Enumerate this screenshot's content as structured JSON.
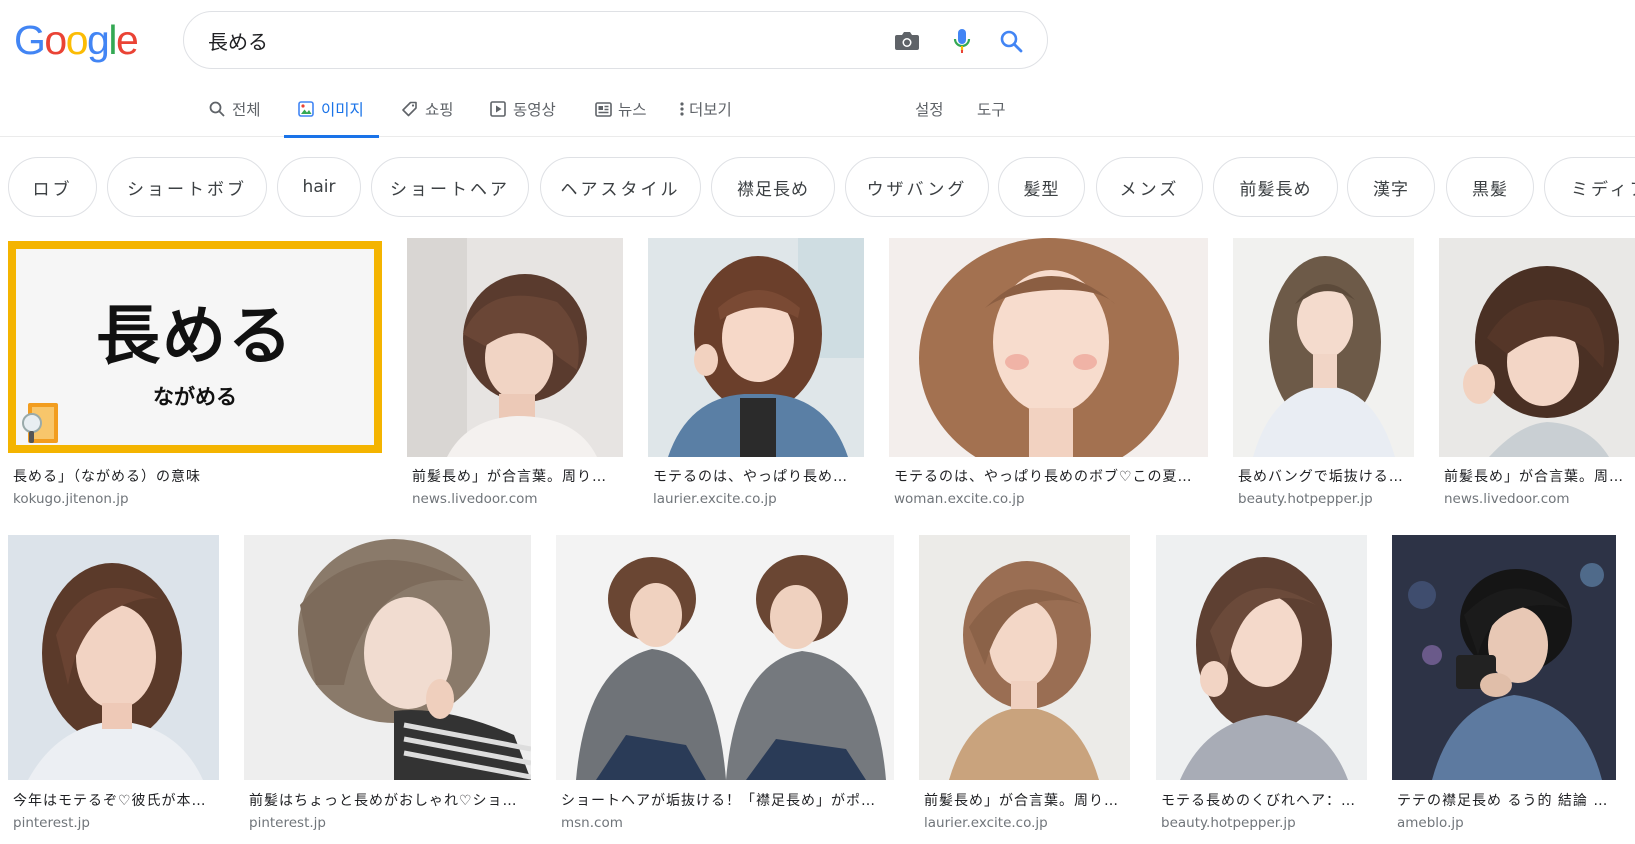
{
  "logo": {
    "letters": [
      "G",
      "o",
      "o",
      "g",
      "l",
      "e"
    ]
  },
  "search": {
    "query": "長める"
  },
  "tabs": [
    "전체",
    "이미지",
    "쇼핑",
    "동영상",
    "뉴스",
    "더보기"
  ],
  "tools": {
    "settings": "설정",
    "tools": "도구"
  },
  "chips": [
    "ロブ",
    "ショートボブ",
    "hair",
    "ショートヘア",
    "ヘアスタイル",
    "襟足長め",
    "ウザバング",
    "髪型",
    "メンズ",
    "前髪長め",
    "漢字",
    "黒髪",
    "ミディア"
  ],
  "results": [
    {
      "title": "長める」（ながめる）の意味",
      "source": "kokugo.jitenon.jp",
      "thumb_text": "長める",
      "thumb_subtext": "ながめる"
    },
    {
      "title": "前髪長め」が合言葉。周りと…",
      "source": "news.livedoor.com"
    },
    {
      "title": "モテるのは、やっぱり長め…",
      "source": "laurier.excite.co.jp"
    },
    {
      "title": "モテるのは、やっぱり長めのボブ♡この夏…",
      "source": "woman.excite.co.jp"
    },
    {
      "title": "長めバングで垢抜ける…",
      "source": "beauty.hotpepper.jp"
    },
    {
      "title": "前髪長め」が合言葉。周り…",
      "source": "news.livedoor.com"
    },
    {
      "title": "今年はモテるぞ♡彼氏が本…",
      "source": "pinterest.jp"
    },
    {
      "title": "前髪はちょっと長めがおしゃれ♡ショ…",
      "source": "pinterest.jp"
    },
    {
      "title": "ショートヘアが垢抜ける！「襟足長め」がポイ…",
      "source": "msn.com"
    },
    {
      "title": "前髪長め」が合言葉。周り…",
      "source": "laurier.excite.co.jp"
    },
    {
      "title": "モテる長めのくびれヘア：L…",
      "source": "beauty.hotpepper.jp"
    },
    {
      "title": "テテの襟足長め るう的 結論 |…",
      "source": "ameblo.jp"
    }
  ],
  "colors": {
    "accent": "#1a73e8",
    "g_blue": "#4285f4",
    "g_red": "#ea4335",
    "g_yellow": "#fbbc05",
    "g_green": "#34a853",
    "thumb_border": "#f4b400"
  }
}
